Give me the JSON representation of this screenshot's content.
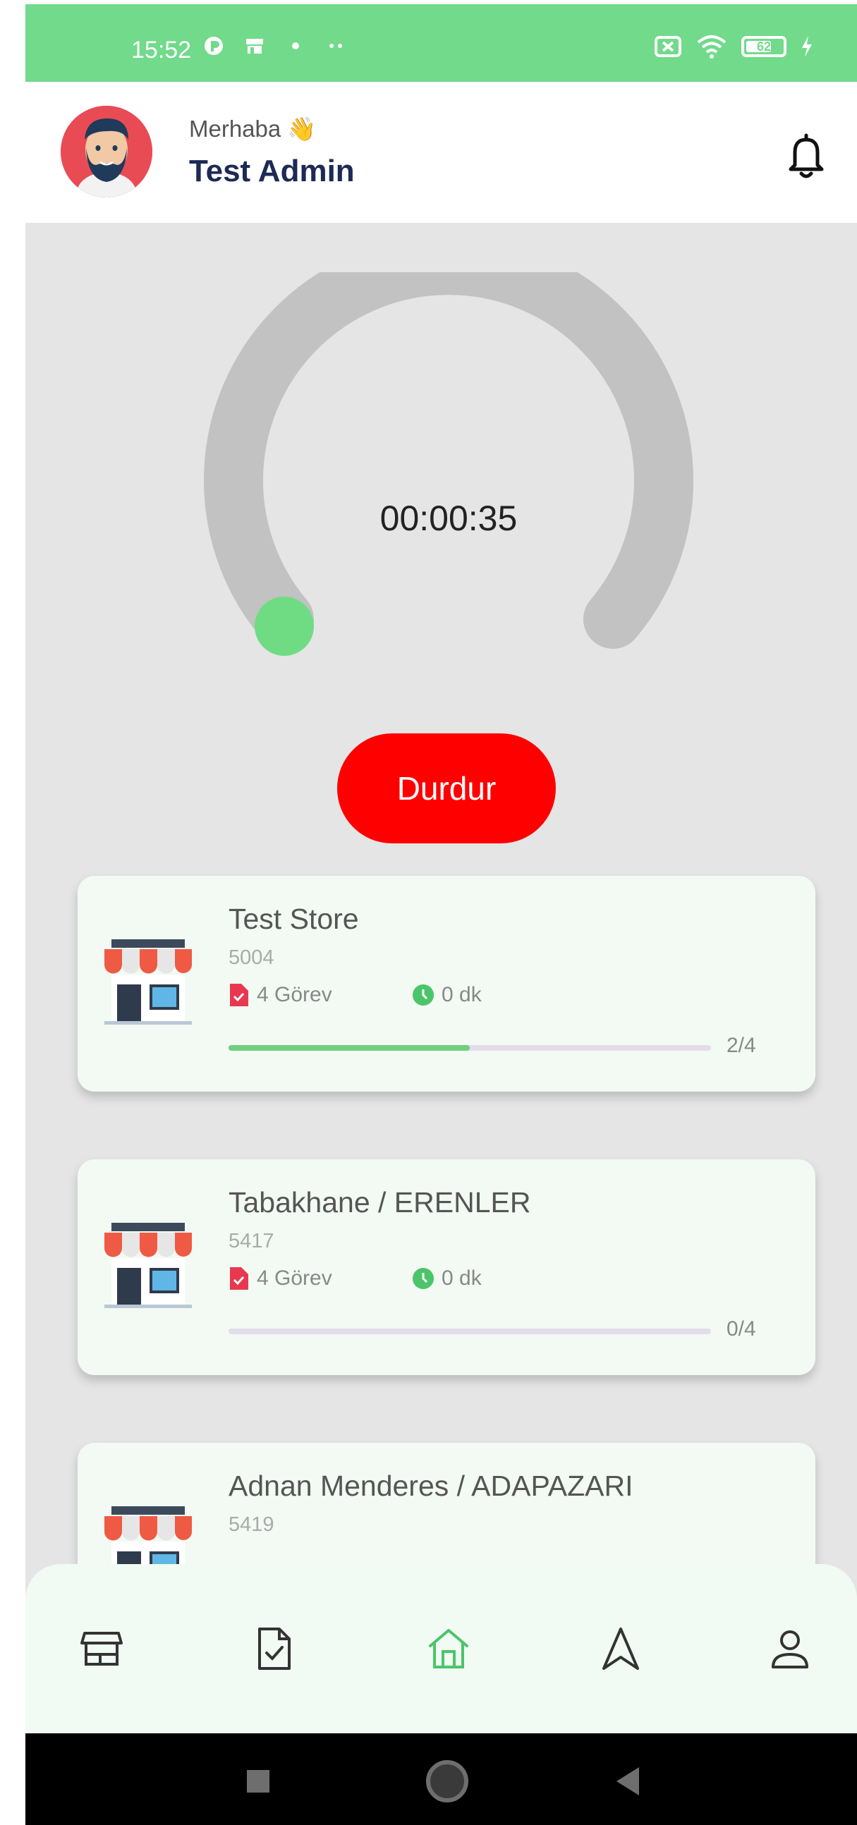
{
  "status_bar": {
    "time": "15:52",
    "battery_level": "62"
  },
  "header": {
    "greeting": "Merhaba 👋",
    "user_name": "Test Admin"
  },
  "timer": {
    "elapsed": "00:00:35",
    "stop_label": "Durdur"
  },
  "stores": [
    {
      "name": "Test Store",
      "code": "5004",
      "tasks": "4 Görev",
      "duration": "0 dk",
      "progress_label": "2/4",
      "progress": 0.5
    },
    {
      "name": "Tabakhane / ERENLER",
      "code": "5417",
      "tasks": "4 Görev",
      "duration": "0 dk",
      "progress_label": "0/4",
      "progress": 0
    },
    {
      "name": "Adnan Menderes / ADAPAZARI",
      "code": "5419",
      "tasks": "",
      "duration": "",
      "progress_label": "",
      "progress": 0
    }
  ],
  "bottom_nav": [
    {
      "icon": "store-icon",
      "active": false
    },
    {
      "icon": "task-document-icon",
      "active": false
    },
    {
      "icon": "home-icon",
      "active": true
    },
    {
      "icon": "navigation-icon",
      "active": false
    },
    {
      "icon": "profile-icon",
      "active": false
    }
  ],
  "colors": {
    "accent_green": "#71da8b",
    "stop_red": "#ff0000",
    "title_navy": "#1d2a55"
  }
}
